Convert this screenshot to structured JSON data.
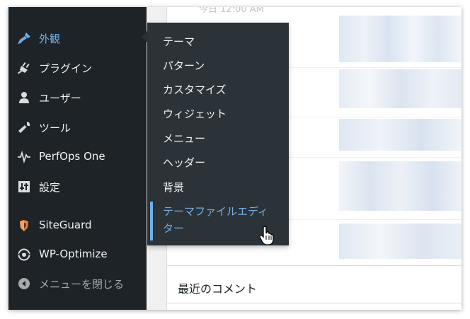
{
  "sidebar": {
    "items": [
      {
        "label": "外観",
        "icon": "appearance-brush-icon"
      },
      {
        "label": "プラグイン",
        "icon": "plugins-icon"
      },
      {
        "label": "ユーザー",
        "icon": "users-icon"
      },
      {
        "label": "ツール",
        "icon": "tools-wrench-icon"
      },
      {
        "label": "PerfOps One",
        "icon": "pulse-icon"
      },
      {
        "label": "設定",
        "icon": "settings-sliders-icon"
      },
      {
        "label": "SiteGuard",
        "icon": "siteguard-shield-icon"
      },
      {
        "label": "WP-Optimize",
        "icon": "wp-optimize-icon"
      },
      {
        "label": "メニューを閉じる",
        "icon": "collapse-arrow-icon"
      }
    ]
  },
  "submenu": {
    "items": [
      "テーマ",
      "パターン",
      "カスタマイズ",
      "ウィジェット",
      "メニュー",
      "ヘッダー",
      "背景",
      "テーマファイルエディ",
      "ター"
    ]
  },
  "content": {
    "section_title": "最近のコメント",
    "peek_text": "今日 12:00 AM"
  },
  "colors": {
    "sidebar_bg": "#1d2327",
    "flyout_bg": "#2c3338",
    "accent": "#72aee6"
  }
}
